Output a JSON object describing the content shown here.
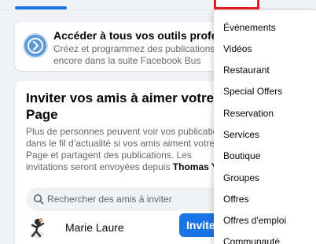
{
  "colors": {
    "accent": "#1b74e4",
    "highlight_border": "#e41e24",
    "background": "#f0f2f5",
    "secondary_text": "#65676b"
  },
  "promo": {
    "icon": "meta-business-suite-icon",
    "title": "Accéder à tous vos outils professi",
    "description": "Créez et programmez des publications plus encore dans la suite Facebook Bus"
  },
  "invite": {
    "title": "Inviter vos amis à aimer votre Page",
    "description_before": "Plus de personnes peuvent voir vos publicatio dans le fil d’actualité si vos amis aiment votre Page et partagent des publications. Les invitations seront envoyées depuis ",
    "description_name": "Thomas Y",
    "search": {
      "icon": "search-icon",
      "placeholder": "Rechercher des amis à inviter"
    },
    "friends": [
      {
        "name": "Marie Laure",
        "button_label": "Inviter"
      }
    ]
  },
  "menu": {
    "items": [
      {
        "label": "Évènements"
      },
      {
        "label": "Vidéos"
      },
      {
        "label": "Restaurant"
      },
      {
        "label": "Special Offers"
      },
      {
        "label": "Reservation"
      },
      {
        "label": "Services"
      },
      {
        "label": "Boutique"
      },
      {
        "label": "Groupes"
      },
      {
        "label": "Offres"
      },
      {
        "label": "Offres d'emploi"
      },
      {
        "label": "Communauté"
      }
    ]
  }
}
